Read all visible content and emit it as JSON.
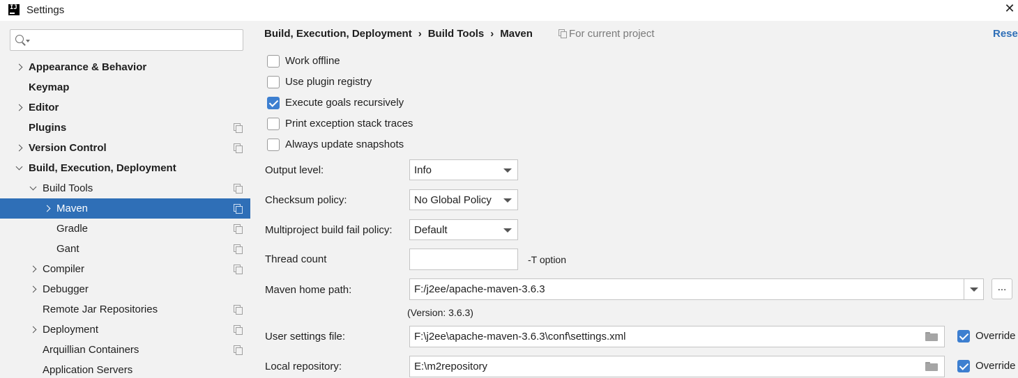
{
  "window": {
    "title": "Settings",
    "close_glyph": "✕"
  },
  "search": {
    "value": "",
    "placeholder": ""
  },
  "tree": [
    {
      "label": "Appearance & Behavior",
      "bold": true,
      "arrow": "right",
      "indent": 0,
      "project": false
    },
    {
      "label": "Keymap",
      "bold": true,
      "arrow": "",
      "indent": 0,
      "project": false
    },
    {
      "label": "Editor",
      "bold": true,
      "arrow": "right",
      "indent": 0,
      "project": false
    },
    {
      "label": "Plugins",
      "bold": true,
      "arrow": "",
      "indent": 0,
      "project": true
    },
    {
      "label": "Version Control",
      "bold": true,
      "arrow": "right",
      "indent": 0,
      "project": true
    },
    {
      "label": "Build, Execution, Deployment",
      "bold": true,
      "arrow": "down",
      "indent": 0,
      "project": false
    },
    {
      "label": "Build Tools",
      "bold": false,
      "arrow": "down",
      "indent": 1,
      "project": true
    },
    {
      "label": "Maven",
      "bold": false,
      "arrow": "right",
      "indent": 2,
      "project": true,
      "selected": true
    },
    {
      "label": "Gradle",
      "bold": false,
      "arrow": "",
      "indent": 2,
      "project": true
    },
    {
      "label": "Gant",
      "bold": false,
      "arrow": "",
      "indent": 2,
      "project": true
    },
    {
      "label": "Compiler",
      "bold": false,
      "arrow": "right",
      "indent": 1,
      "project": true
    },
    {
      "label": "Debugger",
      "bold": false,
      "arrow": "right",
      "indent": 1,
      "project": false
    },
    {
      "label": "Remote Jar Repositories",
      "bold": false,
      "arrow": "",
      "indent": 1,
      "project": true
    },
    {
      "label": "Deployment",
      "bold": false,
      "arrow": "right",
      "indent": 1,
      "project": true
    },
    {
      "label": "Arquillian Containers",
      "bold": false,
      "arrow": "",
      "indent": 1,
      "project": true
    },
    {
      "label": "Application Servers",
      "bold": false,
      "arrow": "",
      "indent": 1,
      "project": false
    }
  ],
  "breadcrumb": {
    "items": [
      "Build, Execution, Deployment",
      "Build Tools",
      "Maven"
    ],
    "separator": "›",
    "scope": "For current project",
    "reset": "Reset"
  },
  "checkboxes": [
    {
      "label": "Work offline",
      "checked": false
    },
    {
      "label": "Use plugin registry",
      "checked": false
    },
    {
      "label": "Execute goals recursively",
      "checked": true
    },
    {
      "label": "Print exception stack traces",
      "checked": false
    },
    {
      "label": "Always update snapshots",
      "checked": false
    }
  ],
  "form": {
    "output_level": {
      "label": "Output level:",
      "value": "Info"
    },
    "checksum_policy": {
      "label": "Checksum policy:",
      "value": "No Global Policy"
    },
    "fail_policy": {
      "label": "Multiproject build fail policy:",
      "value": "Default"
    },
    "thread_count": {
      "label": "Thread count",
      "value": "",
      "hint": "-T option"
    },
    "maven_home": {
      "label": "Maven home path:",
      "value": "F:/j2ee/apache-maven-3.6.3",
      "browse": "...",
      "version": "(Version: 3.6.3)"
    },
    "user_settings": {
      "label": "User settings file:",
      "value": "F:\\j2ee\\apache-maven-3.6.3\\conf\\settings.xml",
      "override_label": "Override",
      "override": true
    },
    "local_repo": {
      "label": "Local repository:",
      "value": "E:\\m2repository",
      "override_label": "Override",
      "override": true
    }
  },
  "colors": {
    "selection": "#2f6fb7",
    "link": "#2f6fb7",
    "checkbox_checked": "#3d7fd0",
    "panel_bg": "#f2f2f2"
  }
}
